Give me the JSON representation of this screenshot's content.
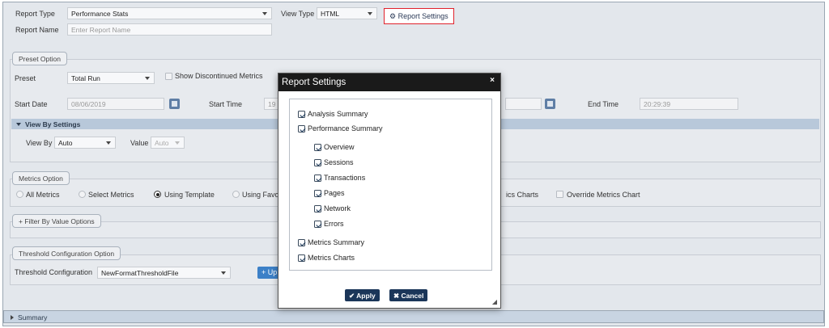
{
  "top": {
    "report_type_label": "Report Type",
    "report_type_value": "Performance Stats",
    "view_type_label": "View Type",
    "view_type_value": "HTML",
    "report_settings_label": "Report Settings",
    "report_name_label": "Report Name",
    "report_name_placeholder": "Enter Report Name"
  },
  "preset": {
    "legend": "Preset Option",
    "preset_label": "Preset",
    "preset_value": "Total Run",
    "show_discontinued_label": "Show Discontinued Metrics",
    "start_date_label": "Start Date",
    "start_date_value": "08/06/2019",
    "start_time_label": "Start Time",
    "start_time_value": "19",
    "end_time_label": "End Time",
    "end_time_value": "20:29:39",
    "view_by_settings": "View By Settings",
    "view_by_label": "View By",
    "view_by_value": "Auto",
    "value_label": "Value",
    "value_value": "Auto"
  },
  "metrics": {
    "legend": "Metrics Option",
    "options": [
      "All Metrics",
      "Select Metrics",
      "Using Template",
      "Using Favo"
    ],
    "selected": "Using Template",
    "charts_label_partial": "ics Charts",
    "override_label": "Override Metrics Chart"
  },
  "filter": {
    "legend": "+ Filter By Value Options"
  },
  "threshold": {
    "legend": "Threshold Configuration Option",
    "config_label": "Threshold Configuration",
    "config_value": "NewFormatThresholdFile",
    "up_button": "+ Up"
  },
  "summary": {
    "label": "Summary"
  },
  "modal": {
    "title": "Report Settings",
    "close": "×",
    "items": {
      "analysis_summary": "Analysis Summary",
      "performance_summary": "Performance Summary",
      "overview": "Overview",
      "sessions": "Sessions",
      "transactions": "Transactions",
      "pages": "Pages",
      "network": "Network",
      "errors": "Errors",
      "metrics_summary": "Metrics Summary",
      "metrics_charts": "Metrics Charts"
    },
    "apply": "✔ Apply",
    "cancel": "✖ Cancel"
  },
  "colors": {
    "highlight": "#e0222c",
    "modal_header": "#1a1a1a",
    "primary_button": "#1b3659",
    "page_bg": "#e3e7ec"
  }
}
